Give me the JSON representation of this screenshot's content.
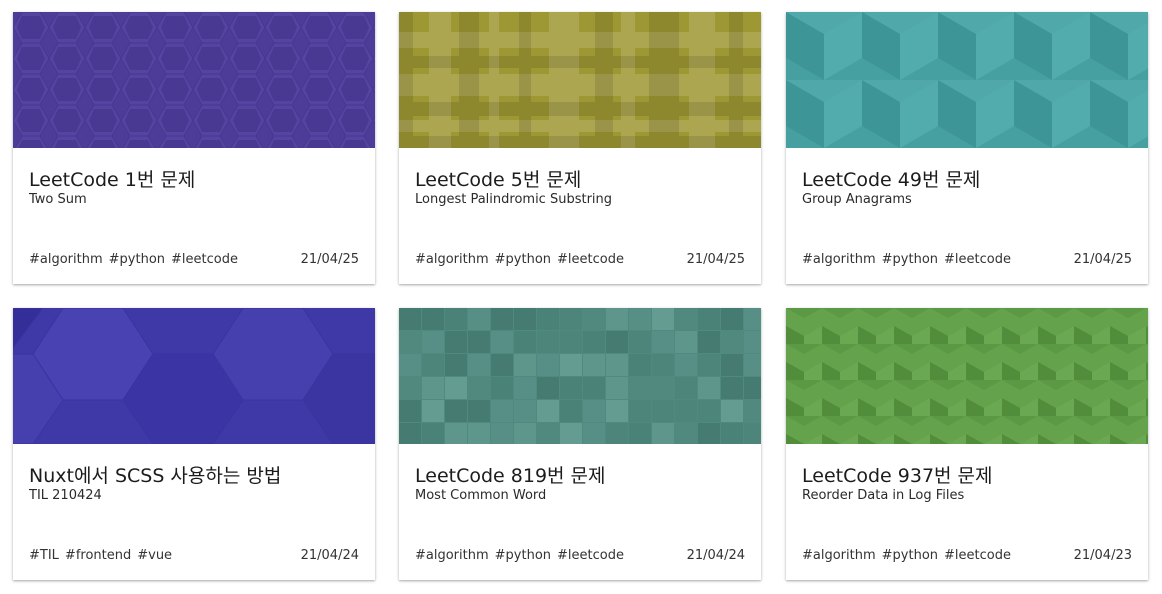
{
  "posts": [
    {
      "title": "LeetCode 1번 문제",
      "subtitle": "Two Sum",
      "tags": [
        "#algorithm",
        "#python",
        "#leetcode"
      ],
      "date": "21/04/25",
      "color": "#52409c"
    },
    {
      "title": "LeetCode 5번 문제",
      "subtitle": "Longest Palindromic Substring",
      "tags": [
        "#algorithm",
        "#python",
        "#leetcode"
      ],
      "date": "21/04/25",
      "color": "#9e9834"
    },
    {
      "title": "LeetCode 49번 문제",
      "subtitle": "Group Anagrams",
      "tags": [
        "#algorithm",
        "#python",
        "#leetcode"
      ],
      "date": "21/04/25",
      "color": "#46a0a2"
    },
    {
      "title": "Nuxt에서 SCSS 사용하는 방법",
      "subtitle": "TIL 210424",
      "tags": [
        "#TIL",
        "#frontend",
        "#vue"
      ],
      "date": "21/04/24",
      "color": "#3f39a8"
    },
    {
      "title": "LeetCode 819번 문제",
      "subtitle": "Most Common Word",
      "tags": [
        "#algorithm",
        "#python",
        "#leetcode"
      ],
      "date": "21/04/24",
      "color": "#4f8a80"
    },
    {
      "title": "LeetCode 937번 문제",
      "subtitle": "Reorder Data in Log Files",
      "tags": [
        "#algorithm",
        "#python",
        "#leetcode"
      ],
      "date": "21/04/23",
      "color": "#5c9944"
    }
  ]
}
